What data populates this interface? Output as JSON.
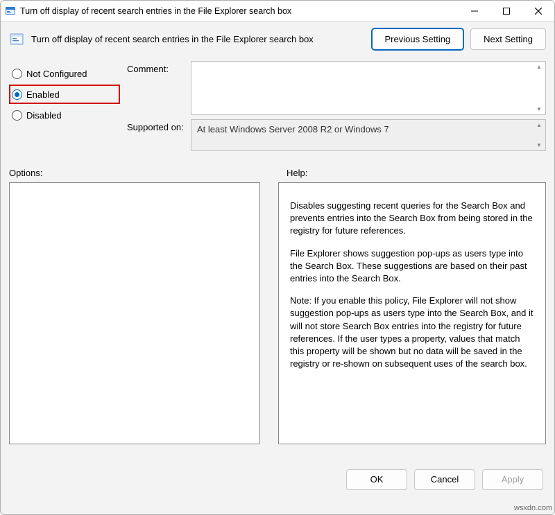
{
  "title": "Turn off display of recent search entries in the File Explorer search box",
  "header": {
    "policy_title": "Turn off display of recent search entries in the File Explorer search box",
    "prev_label": "Previous Setting",
    "next_label": "Next Setting"
  },
  "radios": {
    "not_configured": "Not Configured",
    "enabled": "Enabled",
    "disabled": "Disabled",
    "selected": "enabled"
  },
  "fields": {
    "comment_label": "Comment:",
    "comment_value": "",
    "supported_label": "Supported on:",
    "supported_value": "At least Windows Server 2008 R2 or Windows 7"
  },
  "section_labels": {
    "options": "Options:",
    "help": "Help:"
  },
  "help_paragraphs": [
    "Disables suggesting recent queries for the Search Box and prevents entries into the Search Box from being stored in the registry for future references.",
    "File Explorer shows suggestion pop-ups as users type into the Search Box.  These suggestions are based on their past entries into the Search Box.",
    "Note: If you enable this policy, File Explorer will not show suggestion pop-ups as users type into the Search Box, and it will not store Search Box entries into the registry for future references.  If the user types a property, values that match this property will be shown but no data will be saved in the registry or re-shown on subsequent uses of the search box."
  ],
  "footer": {
    "ok": "OK",
    "cancel": "Cancel",
    "apply": "Apply"
  },
  "watermark": "wsxdn.com"
}
